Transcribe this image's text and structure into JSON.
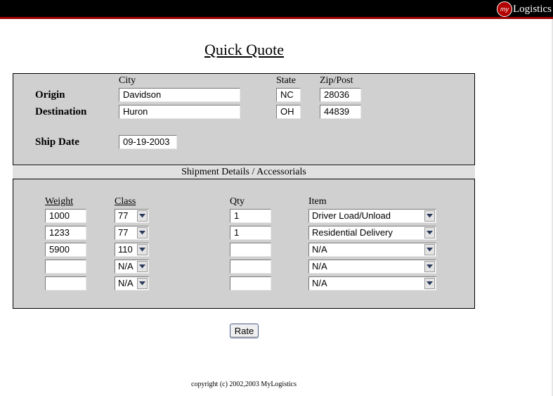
{
  "brand": {
    "logo_prefix": "my",
    "logo_name": "Logistics",
    "accent": "#9b0000"
  },
  "page": {
    "title": "Quick Quote",
    "copyright": "copyright (c) 2002,2003 MyLogistics"
  },
  "locations": {
    "headers": {
      "city": "City",
      "state": "State",
      "zip": "Zip/Post"
    },
    "origin": {
      "label": "Origin",
      "city": "Davidson",
      "state": "NC",
      "zip": "28036"
    },
    "destination": {
      "label": "Destination",
      "city": "Huron",
      "state": "OH",
      "zip": "44839"
    },
    "ship_date": {
      "label": "Ship Date",
      "value": "09-19-2003"
    }
  },
  "shipment": {
    "section_title": "Shipment Details / Accessorials",
    "headers": {
      "weight": "Weight",
      "class": "Class",
      "qty": "Qty",
      "item": "Item"
    },
    "rows": [
      {
        "weight": "1000",
        "class": "77",
        "qty": "1",
        "item": "Driver Load/Unload"
      },
      {
        "weight": "1233",
        "class": "77",
        "qty": "1",
        "item": "Residential Delivery"
      },
      {
        "weight": "5900",
        "class": "110",
        "qty": "",
        "item": "N/A"
      },
      {
        "weight": "",
        "class": "N/A",
        "qty": "",
        "item": "N/A"
      },
      {
        "weight": "",
        "class": "N/A",
        "qty": "",
        "item": "N/A"
      }
    ]
  },
  "actions": {
    "rate_label": "Rate"
  }
}
